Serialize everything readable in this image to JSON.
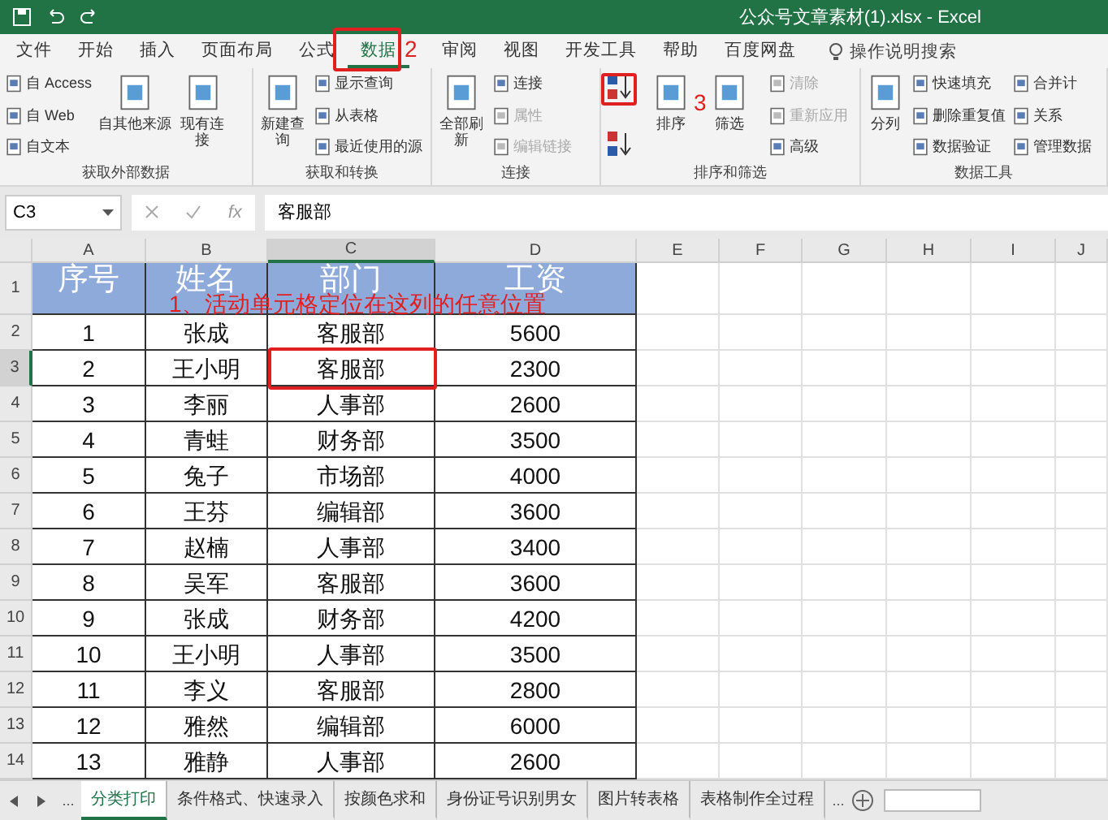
{
  "window": {
    "title": "公众号文章素材(1).xlsx  -  Excel"
  },
  "menu_tabs": [
    {
      "label": "文件",
      "selected": false
    },
    {
      "label": "开始",
      "selected": false
    },
    {
      "label": "插入",
      "selected": false
    },
    {
      "label": "页面布局",
      "selected": false
    },
    {
      "label": "公式",
      "selected": false
    },
    {
      "label": "数据",
      "selected": true
    },
    {
      "label": "审阅",
      "selected": false
    },
    {
      "label": "视图",
      "selected": false
    },
    {
      "label": "开发工具",
      "selected": false
    },
    {
      "label": "帮助",
      "selected": false
    },
    {
      "label": "百度网盘",
      "selected": false
    }
  ],
  "search": {
    "placeholder": "操作说明搜索"
  },
  "ribbon": [
    {
      "label": "获取外部数据",
      "columns": [
        [
          {
            "kind": "small",
            "label": "自 Access",
            "disabled": false
          },
          {
            "kind": "small",
            "label": "自 Web",
            "disabled": false
          },
          {
            "kind": "small",
            "label": "自文本",
            "disabled": false
          }
        ],
        [
          {
            "kind": "large",
            "label": "自其他来源",
            "disabled": false
          }
        ],
        [
          {
            "kind": "large",
            "label": "现有连接",
            "disabled": false
          }
        ]
      ]
    },
    {
      "label": "获取和转换",
      "columns": [
        [
          {
            "kind": "large",
            "label": "新建查询",
            "disabled": false
          }
        ],
        [
          {
            "kind": "small",
            "label": "显示查询",
            "disabled": false
          },
          {
            "kind": "small",
            "label": "从表格",
            "disabled": false
          },
          {
            "kind": "small",
            "label": "最近使用的源",
            "disabled": false
          }
        ]
      ]
    },
    {
      "label": "连接",
      "columns": [
        [
          {
            "kind": "large",
            "label": "全部刷新",
            "disabled": false
          }
        ],
        [
          {
            "kind": "small",
            "label": "连接",
            "disabled": false
          },
          {
            "kind": "small",
            "label": "属性",
            "disabled": true
          },
          {
            "kind": "small",
            "label": "编辑链接",
            "disabled": true
          }
        ]
      ]
    },
    {
      "label": "排序和筛选",
      "columns": [
        [
          {
            "kind": "ascending",
            "disabled": false
          },
          {
            "kind": "descending",
            "disabled": false
          }
        ],
        [
          {
            "kind": "large",
            "label": "排序",
            "disabled": false
          }
        ],
        [
          {
            "kind": "large",
            "label": "筛选",
            "disabled": false
          }
        ],
        [
          {
            "kind": "small",
            "label": "清除",
            "disabled": true
          },
          {
            "kind": "small",
            "label": "重新应用",
            "disabled": true
          },
          {
            "kind": "small",
            "label": "高级",
            "disabled": false
          }
        ]
      ]
    },
    {
      "label": "数据工具",
      "columns": [
        [
          {
            "kind": "large",
            "label": "分列",
            "disabled": false
          }
        ],
        [
          {
            "kind": "small",
            "label": "快速填充",
            "disabled": false
          },
          {
            "kind": "small",
            "label": "删除重复值",
            "disabled": false
          },
          {
            "kind": "small",
            "label": "数据验证",
            "disabled": false
          }
        ],
        [
          {
            "kind": "small",
            "label": "合并计",
            "disabled": false
          },
          {
            "kind": "small",
            "label": "关系",
            "disabled": false
          },
          {
            "kind": "small",
            "label": "管理数据",
            "disabled": false
          }
        ]
      ]
    }
  ],
  "formula_bar": {
    "name_box": "C3",
    "fx": "fx",
    "value": "客服部"
  },
  "columns": [
    {
      "label": "A",
      "selected": false
    },
    {
      "label": "B",
      "selected": false
    },
    {
      "label": "C",
      "selected": true
    },
    {
      "label": "D",
      "selected": false
    },
    {
      "label": "E",
      "selected": false
    },
    {
      "label": "F",
      "selected": false
    },
    {
      "label": "G",
      "selected": false
    },
    {
      "label": "H",
      "selected": false
    },
    {
      "label": "I",
      "selected": false
    },
    {
      "label": "J",
      "selected": false
    }
  ],
  "header": {
    "row": "1",
    "cells": [
      "序号",
      "姓名",
      "部门",
      "工资"
    ]
  },
  "rows": [
    {
      "row": "2",
      "selected": false,
      "cells": [
        "1",
        "张成",
        "客服部",
        "5600"
      ]
    },
    {
      "row": "3",
      "selected": true,
      "cells": [
        "2",
        "王小明",
        "客服部",
        "2300"
      ]
    },
    {
      "row": "4",
      "selected": false,
      "cells": [
        "3",
        "李丽",
        "人事部",
        "2600"
      ]
    },
    {
      "row": "5",
      "selected": false,
      "cells": [
        "4",
        "青蛙",
        "财务部",
        "3500"
      ]
    },
    {
      "row": "6",
      "selected": false,
      "cells": [
        "5",
        "兔子",
        "市场部",
        "4000"
      ]
    },
    {
      "row": "7",
      "selected": false,
      "cells": [
        "6",
        "王芬",
        "编辑部",
        "3600"
      ]
    },
    {
      "row": "8",
      "selected": false,
      "cells": [
        "7",
        "赵楠",
        "人事部",
        "3400"
      ]
    },
    {
      "row": "9",
      "selected": false,
      "cells": [
        "8",
        "吴军",
        "客服部",
        "3600"
      ]
    },
    {
      "row": "10",
      "selected": false,
      "cells": [
        "9",
        "张成",
        "财务部",
        "4200"
      ]
    },
    {
      "row": "11",
      "selected": false,
      "cells": [
        "10",
        "王小明",
        "人事部",
        "3500"
      ]
    },
    {
      "row": "12",
      "selected": false,
      "cells": [
        "11",
        "李义",
        "客服部",
        "2800"
      ]
    },
    {
      "row": "13",
      "selected": false,
      "cells": [
        "12",
        "雅然",
        "编辑部",
        "6000"
      ]
    },
    {
      "row": "14",
      "selected": false,
      "cells": [
        "13",
        "雅静",
        "人事部",
        "2600"
      ]
    }
  ],
  "sheet_tabs": [
    {
      "label": "分类打印",
      "selected": true
    },
    {
      "label": "条件格式、快速录入",
      "selected": false
    },
    {
      "label": "按颜色求和",
      "selected": false
    },
    {
      "label": "身份证号识别男女",
      "selected": false
    },
    {
      "label": "图片转表格",
      "selected": false
    },
    {
      "label": "表格制作全过程",
      "selected": false
    }
  ],
  "sheet_nav": {
    "more_left": "...",
    "more_right": "..."
  },
  "annotations": [
    {
      "kind": "frame"
    },
    {
      "kind": "frame"
    },
    {
      "kind": "frame"
    },
    {
      "kind": "text",
      "text": "2"
    },
    {
      "kind": "text",
      "text": "3"
    },
    {
      "kind": "text",
      "text": "1、活动单元格定位在这列的任意位置"
    }
  ]
}
